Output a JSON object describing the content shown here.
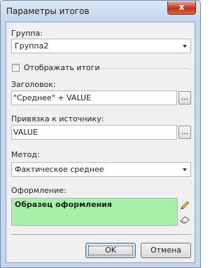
{
  "window": {
    "title": "Параметры итогов",
    "close_glyph": "x"
  },
  "group": {
    "label": "Группа:",
    "value": "Группа2"
  },
  "show_totals": {
    "label": "Отображать итоги",
    "checked": false
  },
  "header": {
    "label": "Заголовок:",
    "value": "\"Среднее\" + VALUE",
    "ellipsis": "..."
  },
  "binding": {
    "label": "Привязка к источнику:",
    "value": "VALUE",
    "ellipsis": "..."
  },
  "method": {
    "label": "Метод:",
    "value": "Фактическое среднее"
  },
  "formatting": {
    "label": "Оформление:",
    "sample": "Образец оформления",
    "sample_bg": "#a8f0a8"
  },
  "icons": {
    "edit": "pencil-icon",
    "clear": "eraser-icon"
  },
  "buttons": {
    "ok": "OK",
    "cancel": "Отмена"
  },
  "colors": {
    "title_bg": "#c5d7ec",
    "close_bg": "#c9492d",
    "client_bg": "#f0f0f0"
  }
}
